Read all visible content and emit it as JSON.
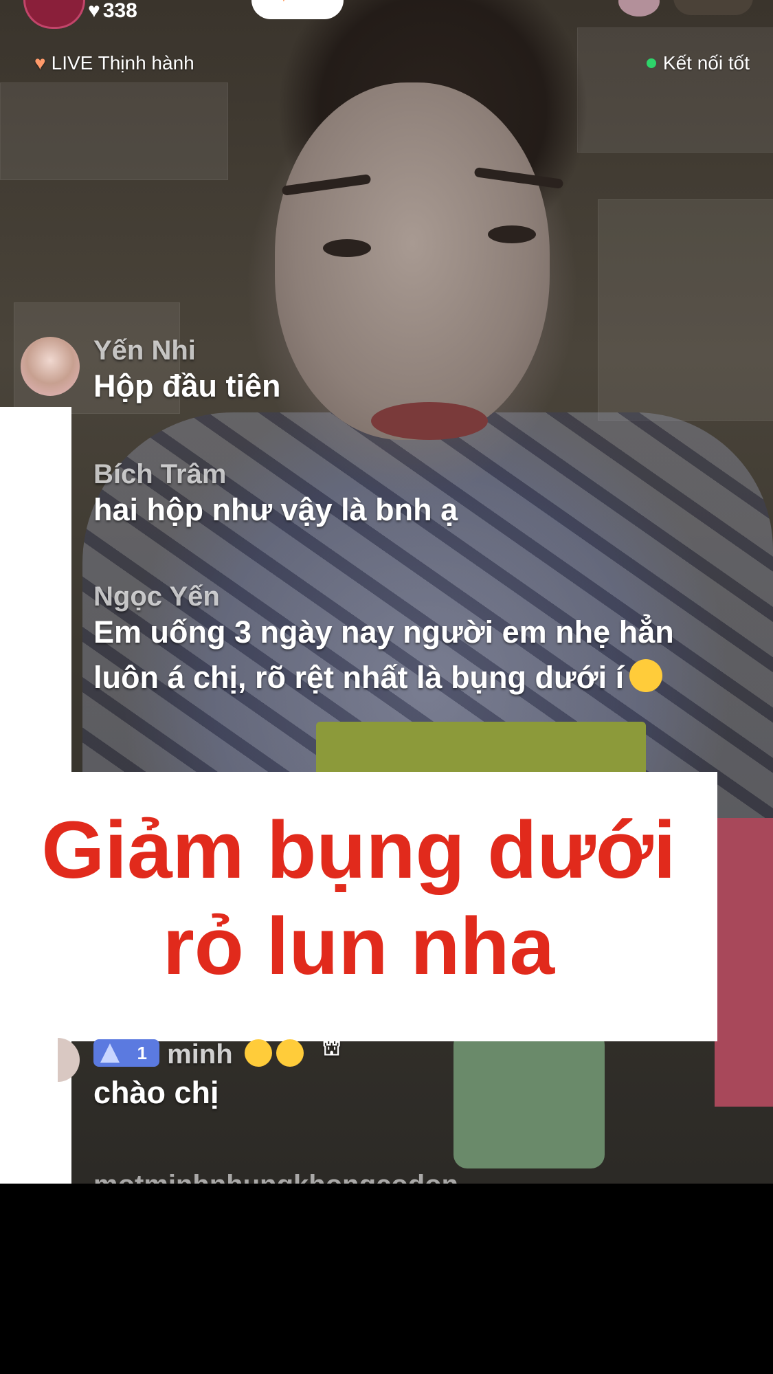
{
  "top_bar": {
    "like_count": "338",
    "live_tag": "LIVE Thịnh hành",
    "connection_status": "Kết nối tốt"
  },
  "comments": [
    {
      "name": "Yến Nhi",
      "message": "Hộp đầu tiên"
    },
    {
      "name": "Bích Trâm",
      "message": "hai hộp như vậy là bnh ạ"
    },
    {
      "name": "Ngọc Yến",
      "message_line1": "Em uống 3 ngày nay người em nhẹ hẳn",
      "message_line2": "luôn á chị, rõ rệt nhất là bụng dưới í"
    },
    {
      "name": "minh",
      "badge_level": "1",
      "message": "chào chị"
    },
    {
      "name_partial": "motminhnhungkhongcodon"
    }
  ],
  "caption": {
    "line1": "Giảm bụng dưới",
    "line2": "rỏ lun nha",
    "color": "#e12a1c"
  },
  "colors": {
    "connection_dot": "#2ed46a",
    "badge": "#5b7ae0"
  },
  "icons": {
    "likes": "heart-icon",
    "live": "heart-icon",
    "connection": "status-dot-icon",
    "gift": "gift-icon"
  }
}
